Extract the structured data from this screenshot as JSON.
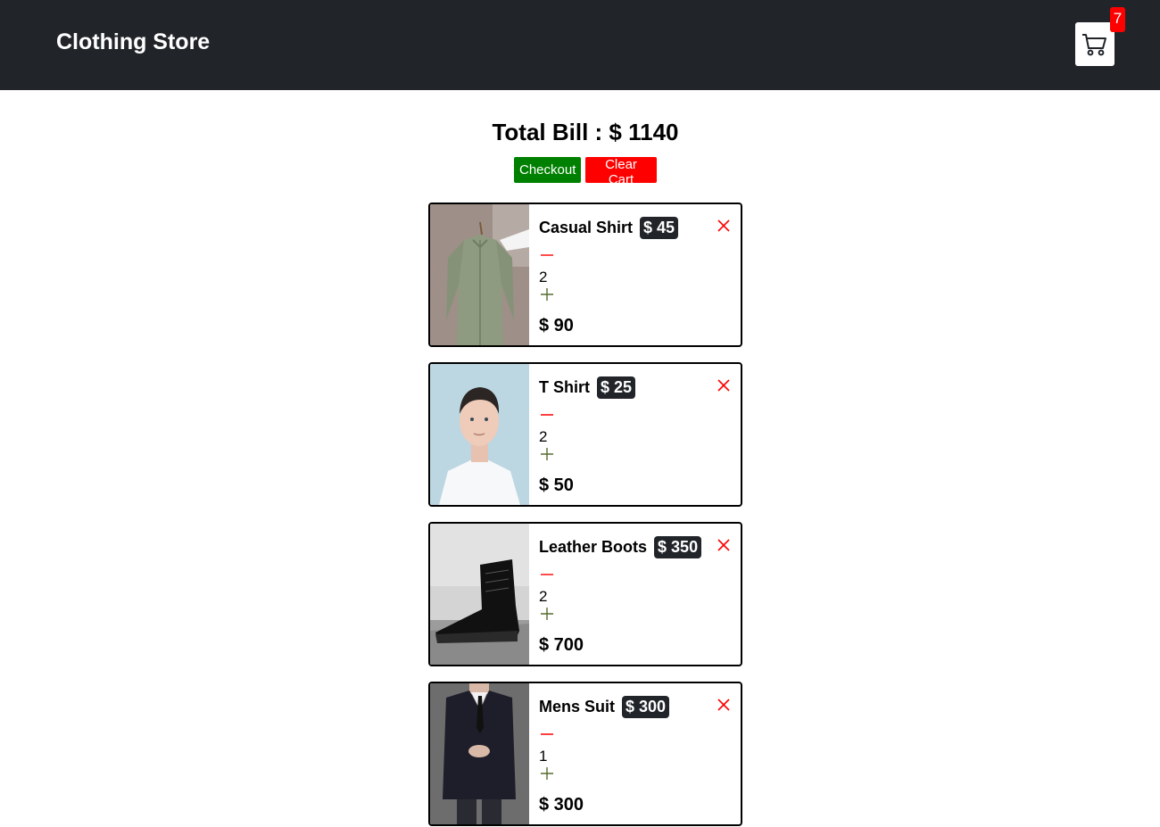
{
  "navbar": {
    "brand": "Clothing Store",
    "cart_count": "7"
  },
  "summary": {
    "total_label": "Total Bill : $ 1140"
  },
  "actions": {
    "checkout_label": "Checkout",
    "clear_label": "Clear Cart"
  },
  "colors": {
    "navbar_bg": "#212529",
    "checkout": "#008000",
    "clear": "#ff0000",
    "badge": "#ff0000",
    "price_badge": "#212529",
    "remove_icon": "#ff0000",
    "plus_icon": "#556b2f"
  },
  "items": [
    {
      "name": "Casual Shirt",
      "price": "$ 45",
      "qty": "2",
      "subtotal": "$ 90",
      "image_icon": "shirt-photo"
    },
    {
      "name": "T Shirt",
      "price": "$ 25",
      "qty": "2",
      "subtotal": "$ 50",
      "image_icon": "tshirt-model-photo"
    },
    {
      "name": "Leather Boots",
      "price": "$ 350",
      "qty": "2",
      "subtotal": "$ 700",
      "image_icon": "boot-photo"
    },
    {
      "name": "Mens Suit",
      "price": "$ 300",
      "qty": "1",
      "subtotal": "$ 300",
      "image_icon": "suit-photo"
    }
  ]
}
